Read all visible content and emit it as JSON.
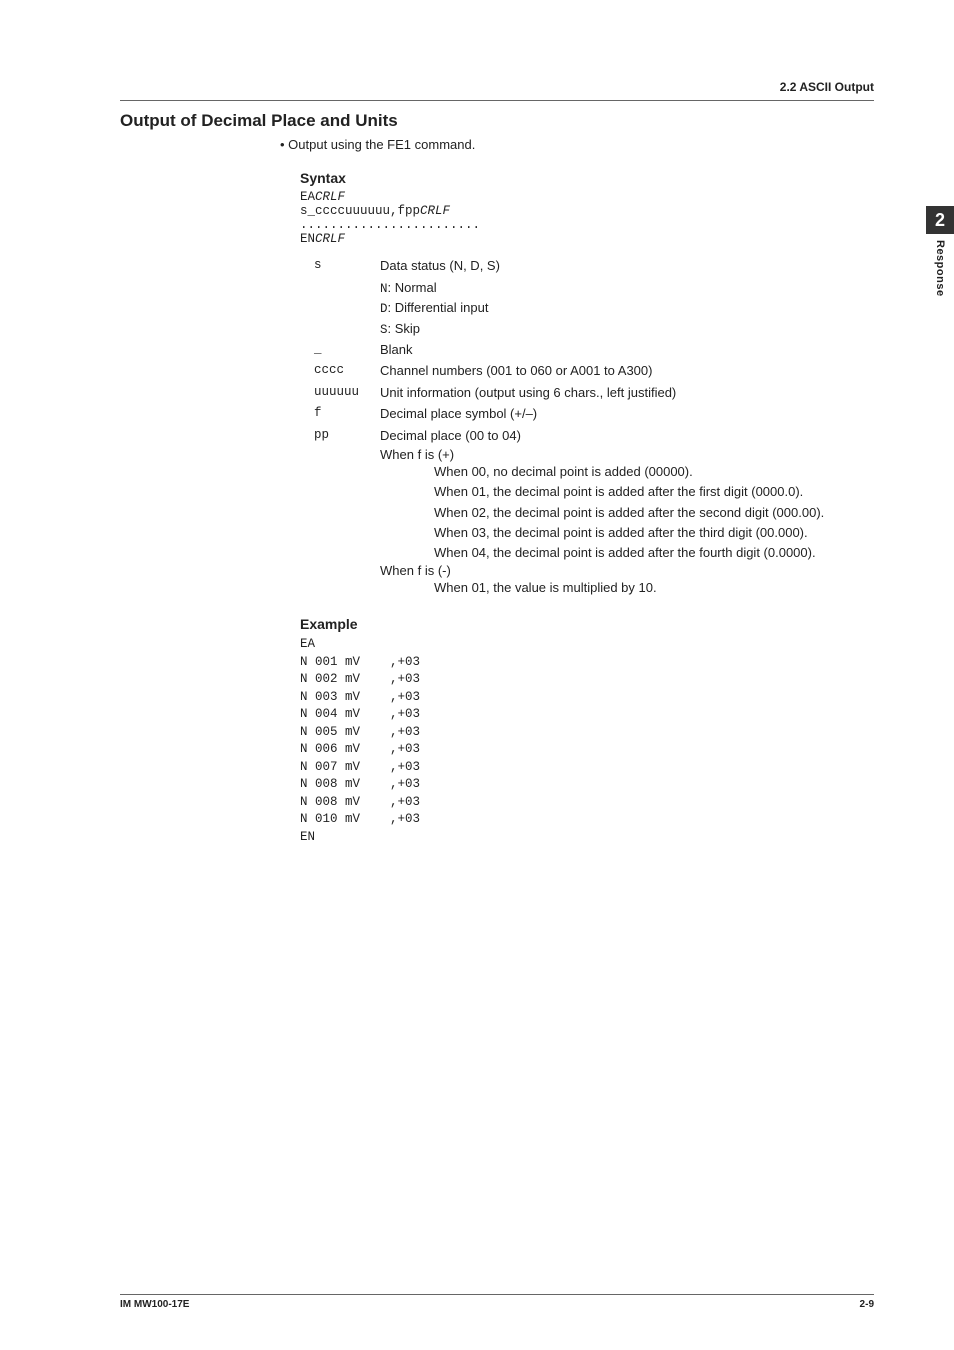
{
  "header": {
    "section": "2.2  ASCII Output"
  },
  "title": "Output of Decimal Place and Units",
  "bullet": "Output using the FE1 command.",
  "syntax": {
    "heading": "Syntax",
    "lines": [
      {
        "pre": "EA",
        "suf": "CRLF"
      },
      {
        "pre": "s_ccccuuuuuu,fpp",
        "suf": "CRLF"
      },
      {
        "pre": "........................",
        "suf": ""
      },
      {
        "pre": "EN",
        "suf": "CRLF"
      }
    ]
  },
  "defs": [
    {
      "sym": "s",
      "text": "Data status (N, D, S)"
    }
  ],
  "status_items": [
    {
      "code": "N",
      "label": ": Normal"
    },
    {
      "code": "D",
      "label": ": Differential input"
    },
    {
      "code": "S",
      "label": ": Skip"
    }
  ],
  "defs2": [
    {
      "sym": "_",
      "text": "Blank"
    },
    {
      "sym": "cccc",
      "text": "Channel numbers (001 to 060 or A001 to A300)"
    },
    {
      "sym": "uuuuuu",
      "text": "Unit information (output using 6 chars., left justified)"
    },
    {
      "sym": "f",
      "text": "Decimal place symbol (+/–)"
    },
    {
      "sym": "pp",
      "text": "Decimal place (00 to 04)"
    }
  ],
  "when_plus_label_a": "When ",
  "when_plus_label_b": " is (",
  "when_plus_label_c": ")",
  "plus_items": [
    {
      "code": "00",
      "text": ", no decimal point is added (00000)."
    },
    {
      "code": "01",
      "text": ", the decimal point is added after the first digit (0000.0)."
    },
    {
      "code": "02",
      "text": ", the decimal point is added after the second digit (000.00)."
    },
    {
      "code": "03",
      "text": ", the decimal point is added after the third digit (00.000)."
    },
    {
      "code": "04",
      "text": ", the decimal point is added after the fourth digit (0.0000)."
    }
  ],
  "minus_items": [
    {
      "code": "01",
      "text": ", the value is multiplied by 10."
    }
  ],
  "example": {
    "heading": "Example",
    "lines": [
      "EA",
      "N 001 mV    ,+03",
      "N 002 mV    ,+03",
      "N 003 mV    ,+03",
      "N 004 mV    ,+03",
      "N 005 mV    ,+03",
      "N 006 mV    ,+03",
      "N 007 mV    ,+03",
      "N 008 mV    ,+03",
      "N 008 mV    ,+03",
      "N 010 mV    ,+03",
      "EN"
    ]
  },
  "tab": {
    "num": "2",
    "label": "Response"
  },
  "footer": {
    "left": "IM MW100-17E",
    "right": "2-9"
  },
  "lit": {
    "f": "f",
    "plus": "+",
    "minus": "-",
    "when_prefix": "When "
  }
}
